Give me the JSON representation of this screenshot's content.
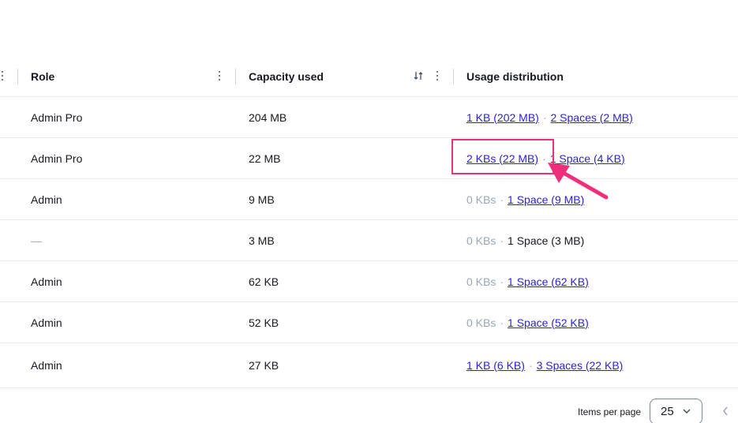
{
  "columns": {
    "role": "Role",
    "capacity": "Capacity used",
    "usage": "Usage distribution"
  },
  "rows": [
    {
      "role": "Admin Pro",
      "capacity": "204 MB",
      "kbs": "1 KB (202 MB)",
      "kbs_link": true,
      "spaces": "2 Spaces (2 MB)",
      "spaces_link": true
    },
    {
      "role": "Admin Pro",
      "capacity": "22 MB",
      "kbs": "2 KBs (22 MB)",
      "kbs_link": true,
      "spaces": "1 Space (4 KB)",
      "spaces_link": true
    },
    {
      "role": "Admin",
      "capacity": "9 MB",
      "kbs": "0 KBs",
      "kbs_link": false,
      "spaces": "1 Space (9 MB)",
      "spaces_link": true
    },
    {
      "role": "—",
      "capacity": "3 MB",
      "kbs": "0 KBs",
      "kbs_link": false,
      "spaces": "1 Space (3 MB)",
      "spaces_link": false
    },
    {
      "role": "Admin",
      "capacity": "62 KB",
      "kbs": "0 KBs",
      "kbs_link": false,
      "spaces": "1 Space (62 KB)",
      "spaces_link": true
    },
    {
      "role": "Admin",
      "capacity": "52 KB",
      "kbs": "0 KBs",
      "kbs_link": false,
      "spaces": "1 Space (52 KB)",
      "spaces_link": true
    },
    {
      "role": "Admin",
      "capacity": "27 KB",
      "kbs": "1 KB (6 KB)",
      "kbs_link": true,
      "spaces": "3 Spaces (22 KB)",
      "spaces_link": true
    }
  ],
  "separator": "·",
  "pagination": {
    "items_per_page_label": "Items per page",
    "items_per_page_value": "25"
  },
  "colors": {
    "link": "#2c1fd6",
    "highlight": "#ee2f7a",
    "muted": "#9ba7b6"
  }
}
